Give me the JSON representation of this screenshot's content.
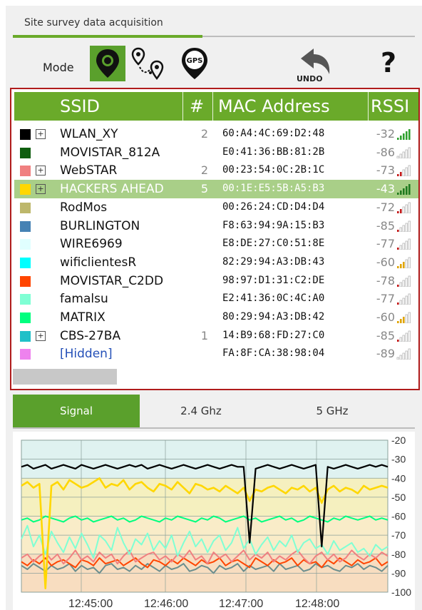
{
  "title": "Site survey data acquisition",
  "mode": {
    "label": "Mode",
    "buttons": [
      {
        "name": "single-point-mode",
        "icon": "map-pin-icon",
        "active": true
      },
      {
        "name": "walk-route-mode",
        "icon": "route-pins-icon",
        "active": false
      },
      {
        "name": "gps-mode",
        "icon": "gps-pin-icon",
        "active": false,
        "text": "GPS"
      }
    ],
    "undo_label": "UNDO",
    "help_label": "?"
  },
  "grid": {
    "columns": {
      "ssid": "SSID",
      "count": "#",
      "mac": "MAC Address",
      "rssi": "RSSI"
    },
    "rows": [
      {
        "color": "#000000",
        "expandable": true,
        "ssid": "WLAN_XY",
        "count": "2",
        "mac": "60:A4:4C:69:D2:48",
        "rssi": "-32",
        "bars": 5,
        "bar_color": "#2fa12f",
        "selected": false
      },
      {
        "color": "#0f5e0f",
        "expandable": false,
        "ssid": "MOVISTAR_812A",
        "count": "",
        "mac": "E0:41:36:BB:81:2B",
        "rssi": "-86",
        "bars": 0,
        "bar_color": "#c0c0c0",
        "selected": false
      },
      {
        "color": "#f08080",
        "expandable": true,
        "ssid": "WebSTAR",
        "count": "2",
        "mac": "00:23:54:0C:2B:1C",
        "rssi": "-73",
        "bars": 2,
        "bar_color": "#c41a1a",
        "selected": false
      },
      {
        "color": "#ffd700",
        "expandable": true,
        "ssid": "HACKERS AHEAD",
        "count": "5",
        "mac": "00:1E:E5:5B:A5:B3",
        "rssi": "-43",
        "bars": 5,
        "bar_color": "#1f7a1f",
        "selected": true
      },
      {
        "color": "#bdb76b",
        "expandable": false,
        "ssid": "RodMos",
        "count": "",
        "mac": "00:26:24:CD:D4:D4",
        "rssi": "-72",
        "bars": 2,
        "bar_color": "#c41a1a",
        "selected": false
      },
      {
        "color": "#4682b4",
        "expandable": false,
        "ssid": "BURLINGTON",
        "count": "",
        "mac": "F8:63:94:9A:15:B3",
        "rssi": "-85",
        "bars": 1,
        "bar_color": "#c41a1a",
        "selected": false
      },
      {
        "color": "#e0ffff",
        "expandable": false,
        "ssid": "WIRE6969",
        "count": "",
        "mac": "E8:DE:27:C0:51:8E",
        "rssi": "-77",
        "bars": 1,
        "bar_color": "#c41a1a",
        "selected": false
      },
      {
        "color": "#00ffff",
        "expandable": false,
        "ssid": "wificlientesR",
        "count": "",
        "mac": "82:29:94:A3:DB:43",
        "rssi": "-60",
        "bars": 3,
        "bar_color": "#e0a400",
        "selected": false
      },
      {
        "color": "#ff4500",
        "expandable": false,
        "ssid": "MOVISTAR_C2DD",
        "count": "",
        "mac": "98:97:D1:31:C2:DE",
        "rssi": "-78",
        "bars": 1,
        "bar_color": "#c41a1a",
        "selected": false
      },
      {
        "color": "#7fffd4",
        "expandable": false,
        "ssid": "famalsu",
        "count": "",
        "mac": "E2:41:36:0C:4C:A0",
        "rssi": "-77",
        "bars": 1,
        "bar_color": "#c41a1a",
        "selected": false
      },
      {
        "color": "#00ff7f",
        "expandable": false,
        "ssid": "MATRIX",
        "count": "",
        "mac": "80:29:94:A3:DB:42",
        "rssi": "-60",
        "bars": 3,
        "bar_color": "#e0a400",
        "selected": false
      },
      {
        "color": "#20c0c8",
        "expandable": true,
        "ssid": "CBS-27BA",
        "count": "1",
        "mac": "14:B9:68:FD:27:C0",
        "rssi": "-85",
        "bars": 1,
        "bar_color": "#c41a1a",
        "selected": false
      },
      {
        "color": "#ee82ee",
        "expandable": false,
        "ssid": "[Hidden]",
        "count": "",
        "mac": "FA:8F:CA:38:98:04",
        "rssi": "-89",
        "bars": 0,
        "bar_color": "#c0c0c0",
        "selected": false
      }
    ]
  },
  "tabs": [
    {
      "label": "Signal",
      "active": true
    },
    {
      "label": "2.4 Ghz",
      "active": false
    },
    {
      "label": "5 GHz",
      "active": false
    }
  ],
  "chart_data": {
    "type": "line",
    "x": [
      "12:45:00",
      "12:46:00",
      "12:47:00",
      "12:48:00"
    ],
    "ylim": [
      -100,
      -20
    ],
    "yticks": [
      -20,
      -30,
      -40,
      -50,
      -60,
      -70,
      -80,
      -90,
      -100
    ],
    "bands": [
      {
        "from": -20,
        "to": -40,
        "color": "#dff2f0"
      },
      {
        "from": -40,
        "to": -60,
        "color": "#f5f0bf"
      },
      {
        "from": -60,
        "to": -80,
        "color": "#f9ecc8"
      },
      {
        "from": -80,
        "to": -100,
        "color": "#f8ddc0"
      }
    ],
    "series": [
      {
        "color": "#000000",
        "values": [
          -34,
          -33,
          -35,
          -34,
          -33,
          -35,
          -34,
          -33,
          -34,
          -35,
          -33,
          -34,
          -35,
          -34,
          -33,
          -34,
          -35,
          -34,
          -33,
          -34,
          -33,
          -35,
          -34,
          -33,
          -34,
          -35,
          -34,
          -33,
          -34,
          -35,
          -34,
          -33,
          -34,
          -35,
          -34,
          -33,
          -34,
          -34,
          -74,
          -35,
          -34,
          -33,
          -34,
          -35,
          -34,
          -33,
          -34,
          -35,
          -34,
          -33,
          -76,
          -34,
          -35,
          -34,
          -33,
          -34,
          -35,
          -34,
          -33,
          -34,
          -33,
          -34
        ]
      },
      {
        "color": "#ffd700",
        "values": [
          -44,
          -42,
          -45,
          -43,
          -98,
          -44,
          -42,
          -46,
          -41,
          -43,
          -45,
          -44,
          -42,
          -40,
          -45,
          -43,
          -44,
          -41,
          -46,
          -43,
          -42,
          -45,
          -47,
          -43,
          -44,
          -46,
          -42,
          -45,
          -48,
          -43,
          -44,
          -46,
          -45,
          -47,
          -44,
          -46,
          -48,
          -45,
          -52,
          -46,
          -47,
          -45,
          -44,
          -46,
          -48,
          -45,
          -46,
          -44,
          -47,
          -45,
          -53,
          -46,
          -44,
          -47,
          -45,
          -46,
          -48,
          -44,
          -46,
          -45,
          -44,
          -45
        ]
      },
      {
        "color": "#00ff7f",
        "values": [
          -62,
          -61,
          -63,
          -62,
          -60,
          -61,
          -62,
          -63,
          -61,
          -60,
          -62,
          -61,
          -63,
          -62,
          -61,
          -60,
          -62,
          -61,
          -63,
          -62,
          -60,
          -61,
          -62,
          -63,
          -61,
          -62,
          -60,
          -61,
          -62,
          -63,
          -61,
          -62,
          -60,
          -61,
          -63,
          -62,
          -61,
          -60,
          -62,
          -61,
          -63,
          -62,
          -61,
          -60,
          -62,
          -61,
          -63,
          -62,
          -60,
          -61,
          -62,
          -63,
          -61,
          -62,
          -60,
          -61,
          -62,
          -61,
          -60,
          -62,
          -61,
          -62
        ]
      },
      {
        "color": "#7fffd4",
        "values": [
          -72,
          -65,
          -76,
          -70,
          -80,
          -68,
          -74,
          -79,
          -71,
          -77,
          -69,
          -75,
          -82,
          -70,
          -73,
          -78,
          -66,
          -74,
          -80,
          -72,
          -75,
          -69,
          -78,
          -73,
          -77,
          -70,
          -81,
          -74,
          -68,
          -76,
          -72,
          -79,
          -73,
          -70,
          -78,
          -74,
          -66,
          -77,
          -72,
          -80,
          -75,
          -71,
          -78,
          -73,
          -76,
          -70,
          -79,
          -74,
          -72,
          -77,
          -75,
          -80,
          -73,
          -78,
          -76,
          -74,
          -79,
          -77,
          -81,
          -75,
          -78,
          -76
        ]
      },
      {
        "color": "#f08080",
        "values": [
          -82,
          -80,
          -84,
          -81,
          -79,
          -83,
          -80,
          -85,
          -82,
          -78,
          -83,
          -81,
          -84,
          -79,
          -82,
          -80,
          -85,
          -81,
          -78,
          -84,
          -82,
          -80,
          -79,
          -83,
          -81,
          -84,
          -80,
          -82,
          -78,
          -83,
          -81,
          -85,
          -79,
          -82,
          -80,
          -84,
          -81,
          -78,
          -83,
          -80,
          -82,
          -79,
          -84,
          -81,
          -83,
          -80,
          -78,
          -82,
          -85,
          -81,
          -79,
          -83,
          -80,
          -84,
          -82,
          -78,
          -81,
          -83,
          -80,
          -82,
          -79,
          -81
        ]
      },
      {
        "color": "#ff4500",
        "values": [
          -84,
          -86,
          -83,
          -85,
          -82,
          -86,
          -84,
          -83,
          -85,
          -87,
          -83,
          -84,
          -86,
          -82,
          -85,
          -84,
          -83,
          -86,
          -84,
          -82,
          -85,
          -87,
          -83,
          -84,
          -86,
          -83,
          -85,
          -82,
          -84,
          -86,
          -83,
          -85,
          -84,
          -82,
          -86,
          -84,
          -83,
          -85,
          -87,
          -82,
          -84,
          -86,
          -83,
          -85,
          -84,
          -82,
          -86,
          -83,
          -85,
          -84,
          -87,
          -83,
          -85,
          -82,
          -84,
          -86,
          -83,
          -85,
          -84,
          -82,
          -86,
          -84
        ]
      },
      {
        "color": "#6b8e8e",
        "values": [
          -86,
          -88,
          -85,
          -87,
          -89,
          -86,
          -88,
          -87,
          -85,
          -89,
          -86,
          -88,
          -87,
          -90,
          -86,
          -85,
          -88,
          -87,
          -89,
          -86,
          -88,
          -85,
          -87,
          -89,
          -86,
          -88,
          -87,
          -85,
          -89,
          -88,
          -86,
          -87,
          -90,
          -86,
          -88,
          -87,
          -85,
          -89,
          -86,
          -88,
          -87,
          -86,
          -89,
          -85,
          -88,
          -87,
          -86,
          -89,
          -88,
          -85,
          -87,
          -86,
          -88,
          -89,
          -86,
          -87,
          -85,
          -88,
          -86,
          -87,
          -89,
          -86
        ]
      }
    ]
  }
}
